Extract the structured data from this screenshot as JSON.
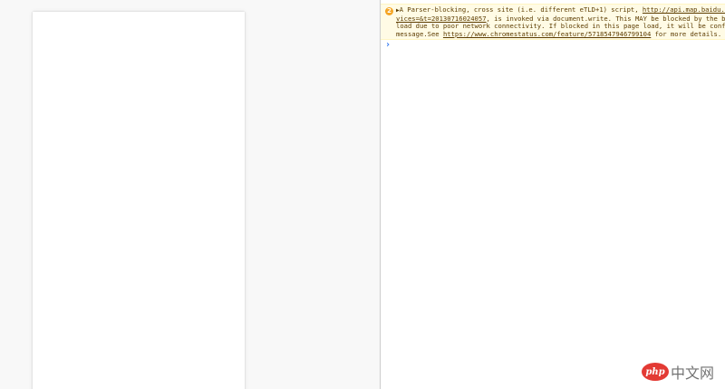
{
  "console": {
    "warning": {
      "badge": "2",
      "triangle": "▶",
      "line1_pre": "A Parser-blocking, cross site (i.e. different eTLD+1) script, ",
      "link1_part1": "http://api.map.baidu.com/",
      "link1_part2": "vices=&t=20130716024057",
      "line2_post": ", is invoked via document.write. This MAY be blocked by the browse",
      "line3": "load due to poor network connectivity. If blocked in this page load, it will be confirmed",
      "line4_pre": "message.See ",
      "link2": "https://www.chromestatus.com/feature/5718547946799104",
      "line4_post": " for more details."
    },
    "prompt": "›"
  },
  "watermark": {
    "logo": "php",
    "text": "中文网"
  },
  "colors": {
    "warning_bg": "#fffbe5",
    "warning_text": "#5c3c00",
    "badge": "#f5a524",
    "prompt": "#367cf1"
  }
}
